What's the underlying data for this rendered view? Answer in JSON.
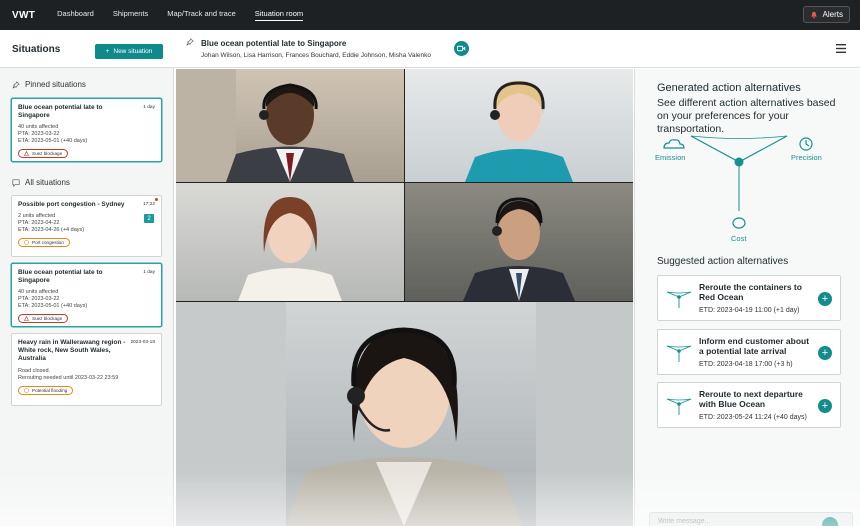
{
  "app": {
    "logo": "VWT"
  },
  "nav": {
    "items": [
      {
        "label": "Dashboard"
      },
      {
        "label": "Shipments"
      },
      {
        "label": "Map/Track and trace"
      },
      {
        "label": "Situation room"
      }
    ],
    "alerts_label": "Alerts"
  },
  "sidebar": {
    "title": "Situations",
    "new_button": "New situation",
    "pinned_label": "Pinned situations",
    "all_label": "All situations",
    "pinned": [
      {
        "title": "Blue ocean potential late to Singapore",
        "date": "1 day",
        "lines": [
          "40 units affected",
          "PTA: 2023-03-22",
          "ETA: 2023-05-01 (+40 days)"
        ],
        "tag": "Suez blockage"
      }
    ],
    "all": [
      {
        "title": "Possible port congestion - Sydney",
        "date": "17:22",
        "badge": "2",
        "lines": [
          "2 units affected",
          "PTA: 2023-04-22",
          "ETA: 2023-04-26 (+4 days)"
        ],
        "tag": "Port congestion"
      },
      {
        "title": "Blue ocean potential late to Singapore",
        "date": "1 day",
        "lines": [
          "40 units affected",
          "PTA: 2023-03-22",
          "ETA: 2023-05-01 (+40 days)"
        ],
        "tag": "Suez blockage"
      },
      {
        "title": "Heavy rain in Wallerawang region - White rock, New South Wales, Australia",
        "date": "2023-03-18",
        "lines": [
          "Road closed.",
          "Rerouting needed until 2023-03-22 23:59"
        ],
        "tag": "Potential flooding"
      }
    ]
  },
  "chat": {
    "title": "Blue ocean potential late to Singapore",
    "participants": "Johan Wilson, Lisa Harrison, Frances Bouchard, Eddie Johnson, Misha Valenko"
  },
  "panel": {
    "title": "Generated action alternatives",
    "description": "See different action alternatives based on your preferences for your transportation.",
    "radar_labels": {
      "emission": "Emission",
      "precision": "Precision",
      "cost": "Cost"
    },
    "suggested_title": "Suggested action alternatives",
    "alternatives": [
      {
        "title": "Reroute the containers to Red Ocean",
        "etd": "ETD: 2023-04-19 11:00 (+1 day)"
      },
      {
        "title": "Inform end customer about a potential late arrival",
        "etd": "ETD: 2023-04-18 17:00 (+3 h)"
      },
      {
        "title": "Reroute to next departure with Blue Ocean",
        "etd": "ETD: 2023-05-24 11:24 (+40 days)"
      }
    ],
    "message_placeholder": "Write message..."
  },
  "colors": {
    "accent": "#0f8a8a",
    "nav_bg": "#1e2123",
    "alert_red": "#c0392b",
    "warning_orange": "#e08a1e"
  }
}
